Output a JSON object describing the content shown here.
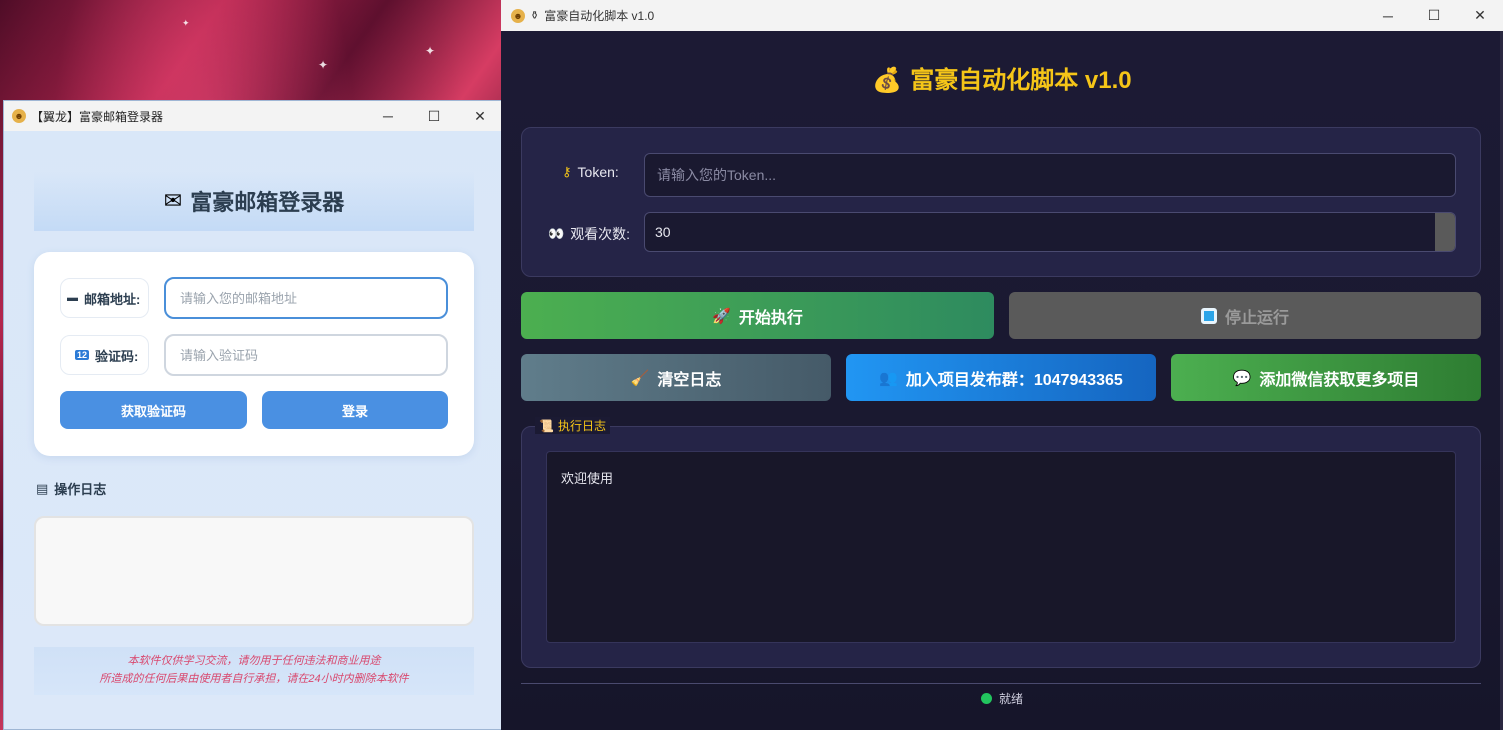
{
  "left_window": {
    "title": "【翼龙】富豪邮箱登录器",
    "header": "富豪邮箱登录器",
    "email_label": "邮箱地址:",
    "email_placeholder": "请输入您的邮箱地址",
    "code_label": "验证码:",
    "code_placeholder": "请输入验证码",
    "get_code_button": "获取验证码",
    "login_button": "登录",
    "log_title": "操作日志",
    "disclaimer_line1": "本软件仅供学习交流，请勿用于任何违法和商业用途",
    "disclaimer_line2": "所造成的任何后果由使用者自行承担，请在24小时内删除本软件"
  },
  "right_window": {
    "title": "富豪自动化脚本 v1.0",
    "header": "富豪自动化脚本 v1.0",
    "token_label": "Token:",
    "token_placeholder": "请输入您的Token...",
    "views_label": "观看次数:",
    "views_value": "30",
    "start_button": "开始执行",
    "stop_button": "停止运行",
    "clear_log_button": "清空日志",
    "join_group_button": "加入项目发布群：1047943365",
    "wechat_button": "添加微信获取更多项目",
    "log_section_title": "执行日志",
    "log_text": "欢迎使用",
    "status_text": "就绪"
  },
  "colors": {
    "accent_gold": "#f5c518",
    "blue_button": "#4a90e2",
    "start_green": "#4caf50",
    "status_green": "#22c55e",
    "disclaimer_pink": "#d9486e"
  }
}
